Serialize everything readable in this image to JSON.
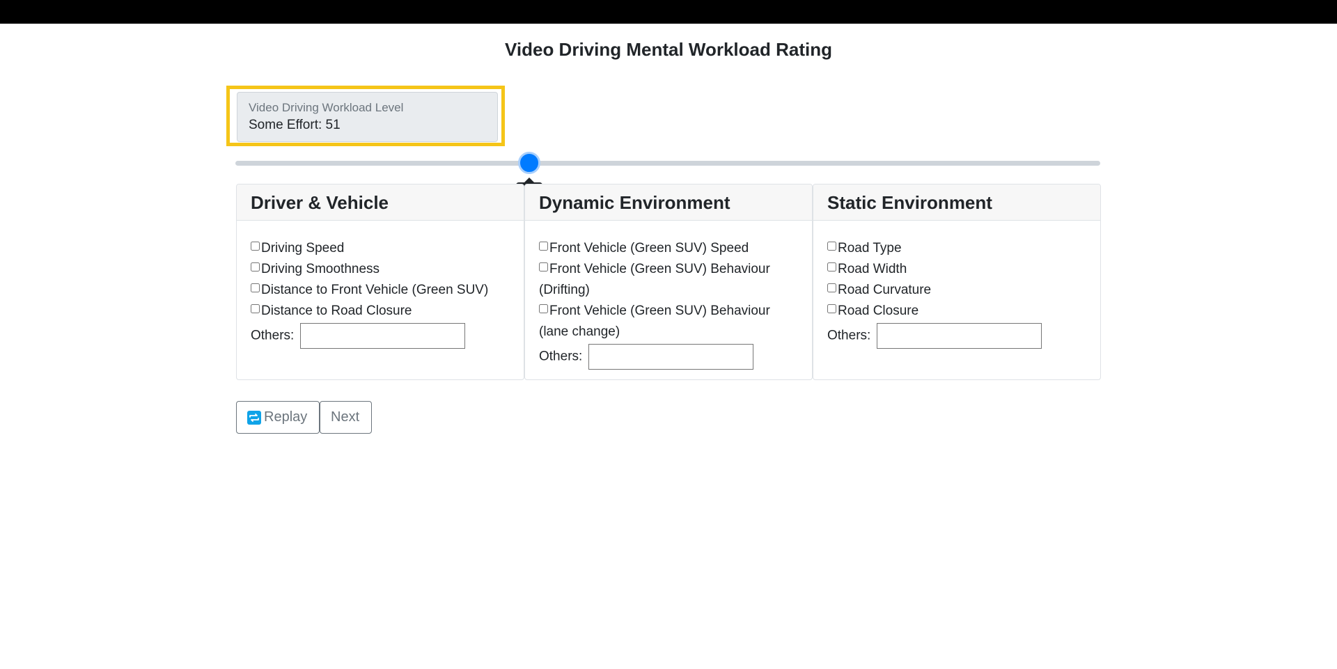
{
  "page": {
    "title": "Video Driving Mental Workload Rating"
  },
  "workload": {
    "label": "Video Driving Workload Level",
    "value_text": "Some Effort: 51"
  },
  "slider": {
    "value": 51,
    "min": 0,
    "max": 150,
    "tooltip": "51",
    "thumb_color": "#007bff"
  },
  "cards": [
    {
      "title": "Driver & Vehicle",
      "items": [
        "Driving Speed",
        "Driving Smoothness",
        "Distance to Front Vehicle (Green SUV)",
        "Distance to Road Closure"
      ],
      "others_label": "Others:"
    },
    {
      "title": "Dynamic Environment",
      "items": [
        "Front Vehicle (Green SUV) Speed",
        "Front Vehicle (Green SUV) Behaviour (Drifting)",
        "Front Vehicle (Green SUV) Behaviour (lane change)"
      ],
      "others_label": "Others:"
    },
    {
      "title": "Static Environment",
      "items": [
        "Road Type",
        "Road Width",
        "Road Curvature",
        "Road Closure"
      ],
      "others_label": "Others:"
    }
  ],
  "buttons": {
    "replay_label": "Replay",
    "replay_icon": "replay-icon",
    "next_label": "Next"
  },
  "colors": {
    "highlight": "#f5c518",
    "accent": "#007bff"
  }
}
